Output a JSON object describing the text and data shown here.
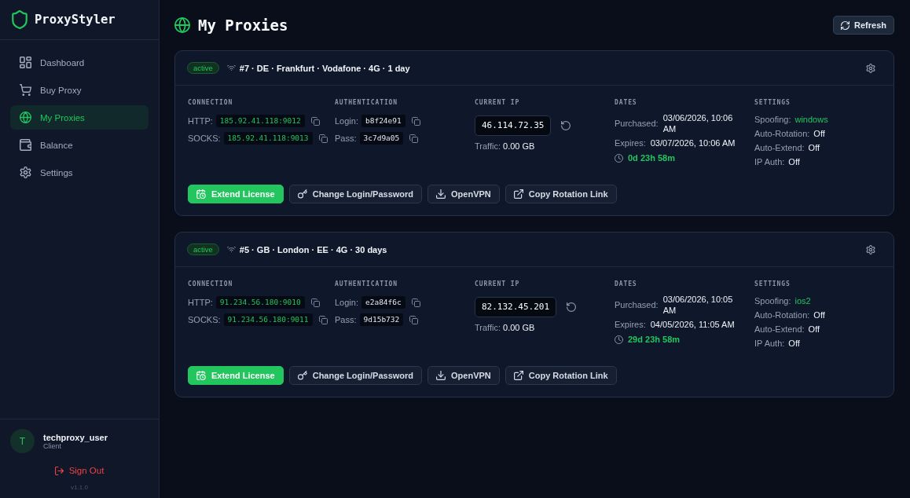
{
  "sidebar": {
    "brand": "ProxyStyler",
    "nav": [
      {
        "label": "Dashboard",
        "selected": false
      },
      {
        "label": "Buy Proxy",
        "selected": false
      },
      {
        "label": "My Proxies",
        "selected": true
      },
      {
        "label": "Balance",
        "selected": false
      },
      {
        "label": "Settings",
        "selected": false
      }
    ],
    "user": {
      "initial": "T",
      "name": "techproxy_user",
      "role": "Client"
    },
    "sign_out": "Sign Out",
    "version": "v1.1.0"
  },
  "header": {
    "title": "My Proxies",
    "refresh": "Refresh"
  },
  "proxies": [
    {
      "status": "active",
      "title": "#7 · DE · Frankfurt · Vodafone · 4G · 1 day",
      "connection": {
        "heading": "CONNECTION",
        "rows": [
          {
            "label": "HTTP:",
            "value": "185.92.41.118:9012"
          },
          {
            "label": "SOCKS:",
            "value": "185.92.41.118:9013"
          }
        ]
      },
      "authentication": {
        "heading": "AUTHENTICATION",
        "rows": [
          {
            "label": "Login:",
            "value": "b8f24e91"
          },
          {
            "label": "Pass:",
            "value": "3c7d9a05"
          }
        ]
      },
      "current_ip": {
        "heading": "CURRENT IP",
        "ip": "46.114.72.35",
        "traffic_label": "Traffic:",
        "traffic": "0.00 GB"
      },
      "dates": {
        "heading": "DATES",
        "rows": [
          {
            "label": "Purchased:",
            "value": "03/06/2026, 10:06 AM"
          },
          {
            "label": "Expires:",
            "value": "03/07/2026, 10:06 AM"
          }
        ],
        "remaining": "0d 23h 58m"
      },
      "settings": {
        "heading": "SETTINGS",
        "rows": [
          {
            "label": "Spoofing:",
            "value": "windows",
            "highlight": true
          },
          {
            "label": "Auto-Rotation:",
            "value": "Off",
            "highlight": false
          },
          {
            "label": "Auto-Extend:",
            "value": "Off",
            "highlight": false
          },
          {
            "label": "IP Auth:",
            "value": "Off",
            "highlight": false
          }
        ]
      },
      "actions": [
        {
          "label": "Extend License",
          "kind": "primary"
        },
        {
          "label": "Change Login/Password",
          "kind": "secondary"
        },
        {
          "label": "OpenVPN",
          "kind": "secondary"
        },
        {
          "label": "Copy Rotation Link",
          "kind": "secondary"
        }
      ]
    },
    {
      "status": "active",
      "title": "#5 · GB · London · EE · 4G · 30 days",
      "connection": {
        "heading": "CONNECTION",
        "rows": [
          {
            "label": "HTTP:",
            "value": "91.234.56.180:9010"
          },
          {
            "label": "SOCKS:",
            "value": "91.234.56.180:9011"
          }
        ]
      },
      "authentication": {
        "heading": "AUTHENTICATION",
        "rows": [
          {
            "label": "Login:",
            "value": "e2a84f6c"
          },
          {
            "label": "Pass:",
            "value": "9d15b732"
          }
        ]
      },
      "current_ip": {
        "heading": "CURRENT IP",
        "ip": "82.132.45.201",
        "traffic_label": "Traffic:",
        "traffic": "0.00 GB"
      },
      "dates": {
        "heading": "DATES",
        "rows": [
          {
            "label": "Purchased:",
            "value": "03/06/2026, 10:05 AM"
          },
          {
            "label": "Expires:",
            "value": "04/05/2026, 11:05 AM"
          }
        ],
        "remaining": "29d 23h 58m"
      },
      "settings": {
        "heading": "SETTINGS",
        "rows": [
          {
            "label": "Spoofing:",
            "value": "ios2",
            "highlight": true
          },
          {
            "label": "Auto-Rotation:",
            "value": "Off",
            "highlight": false
          },
          {
            "label": "Auto-Extend:",
            "value": "Off",
            "highlight": false
          },
          {
            "label": "IP Auth:",
            "value": "Off",
            "highlight": false
          }
        ]
      },
      "actions": [
        {
          "label": "Extend License",
          "kind": "primary"
        },
        {
          "label": "Change Login/Password",
          "kind": "secondary"
        },
        {
          "label": "OpenVPN",
          "kind": "secondary"
        },
        {
          "label": "Copy Rotation Link",
          "kind": "secondary"
        }
      ]
    }
  ]
}
